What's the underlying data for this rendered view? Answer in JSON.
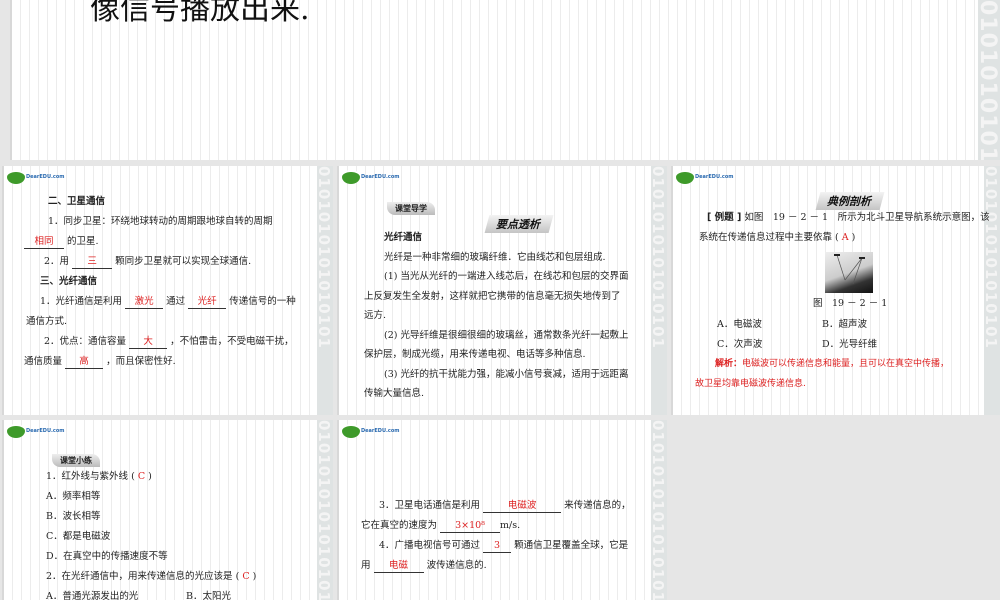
{
  "slide_top": {
    "text": "像信号播放出来."
  },
  "logo_text": "DearEDU.com",
  "watermark": "0101010101010101",
  "slide1": {
    "heading1": "二、卫星通信",
    "l1": "1．同步卫星：环绕地球转动的周期跟地球自转的周期",
    "b1": "相同",
    "l2": "的卫星.",
    "l3a": "2．用",
    "b2": "三",
    "l3b": "颗同步卫星就可以实现全球通信.",
    "heading2": "三、光纤通信",
    "l4a": "1．光纤通信是利用",
    "b3": "激光",
    "l4b": "通过",
    "b4": "光纤",
    "l4c": "传递信号的一种",
    "l5": "通信方式.",
    "l6a": "2．优点：通信容量",
    "b5": "大",
    "l6b": "，不怕雷击，不受电磁干扰，",
    "l7a": "通信质量",
    "b6": "高",
    "l7b": "，而且保密性好."
  },
  "slide2": {
    "tag": "课堂导学",
    "head": "要点透析",
    "title": "光纤通信",
    "l1": "光纤是一种非常细的玻璃纤维．它由线芯和包层组成.",
    "l2": "(1) 当光从光纤的一端进入线芯后，在线芯和包层的交界面",
    "l3": "上反复发生全发射，这样就把它携带的信息毫无损失地传到了",
    "l4": "远方.",
    "l5": "(2) 光导纤维是很细很细的玻璃丝，通常数条光纤一起敷上",
    "l6": "保护层，制成光缆，用来传递电视、电话等多种信息.",
    "l7": "(3) 光纤的抗干扰能力强，能减小信号衰减，适用于远距离",
    "l8": "传输大量信息."
  },
  "slide3": {
    "head": "典例剖析",
    "label": "[ 例题 ]",
    "l1": "如图　19 － 2 － 1　所示为北斗卫星导航系统示意图，该",
    "l2": "系统在传递信息过程中主要依靠 (",
    "answer": "A",
    "l2b": ")",
    "caption": "图　19 － 2 － 1",
    "optA": "A．电磁波",
    "optB": "B．超声波",
    "optC": "C．次声波",
    "optD": "D．光导纤维",
    "exp_label": "解析：",
    "exp1": "电磁波可以传递信息和能量，且可以在真空中传播，",
    "exp2": "故卫星均靠电磁波传递信息."
  },
  "slide4": {
    "tag": "课堂小练",
    "q1": "1．红外线与紫外线 (",
    "a1": "C",
    "q1b": ")",
    "A": "A．频率相等",
    "B": "B．波长相等",
    "C": "C．都是电磁波",
    "D": "D．在真空中的传播速度不等",
    "q2": "2．在光纤通信中，用来传递信息的光应该是 (",
    "a2": "C",
    "q2b": ")",
    "q2A": "A．普通光源发出的光",
    "q2B": "B．太阳光"
  },
  "slide5": {
    "l1a": "3．卫星电话通信是利用",
    "b1": "电磁波",
    "l1b": "来传递信息的，",
    "l2a": "它在真空的速度为",
    "b2": "3×10⁸",
    "l2b": "m/s.",
    "l3a": "4．广播电视信号可通过",
    "b3": "3",
    "l3b": "颗通信卫星覆盖全球，它是",
    "l4a": "用",
    "b4": "电磁",
    "l4b": "波传递信息的."
  }
}
